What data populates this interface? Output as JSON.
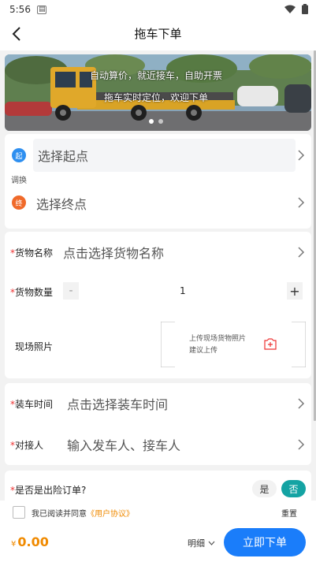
{
  "status": {
    "time": "5:56"
  },
  "nav": {
    "title": "拖车下单"
  },
  "banner": {
    "line1": "自动算价，就近接车，自助开票",
    "line2": "拖车实时定位，欢迎下单"
  },
  "route": {
    "start_badge": "起",
    "start_placeholder": "选择起点",
    "swap_label": "调换",
    "end_badge": "终",
    "end_placeholder": "选择终点"
  },
  "cargo": {
    "name_label": "货物名称",
    "name_placeholder": "点击选择货物名称",
    "qty_label": "货物数量",
    "qty_minus": "-",
    "qty_value": "1",
    "qty_plus": "+",
    "photo_label": "现场照片",
    "upload_line1": "上传现场货物照片",
    "upload_line2": "建议上传"
  },
  "loading": {
    "time_label": "装车时间",
    "time_placeholder": "点击选择装车时间",
    "contact_label": "对接人",
    "contact_placeholder": "输入发车人、接车人"
  },
  "insurance": {
    "label": "是否是出险订单?",
    "yes": "是",
    "no": "否"
  },
  "agreement": {
    "prefix": "我已阅读并同意",
    "link": "《用户协议》",
    "reset": "重置"
  },
  "footer": {
    "currency": "¥",
    "price": "0.00",
    "detail": "明细",
    "submit": "立即下单"
  },
  "colors": {
    "accent": "#1a7dfa",
    "price": "#f08a00",
    "toggle_on": "#14a3a3",
    "required": "#e33333"
  }
}
